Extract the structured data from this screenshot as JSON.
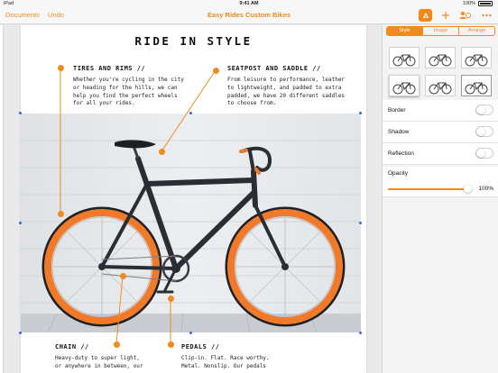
{
  "status_bar": {
    "carrier": "iPad",
    "time": "9:41 AM",
    "battery": "100%"
  },
  "toolbar": {
    "documents_label": "Documents",
    "undo_label": "Undo",
    "title": "Easy Rides Custom Bikes"
  },
  "page": {
    "heading": "RIDE IN STYLE",
    "sections": [
      {
        "title": "TIRES AND RIMS //",
        "body": [
          "Whether you're cycling in the city",
          "or heading for the hills, we can",
          "help you find the perfect wheels",
          "for all your rides."
        ]
      },
      {
        "title": "SEATPOST AND SADDLE //",
        "body": [
          "From leisure to performance, leather",
          "to lightweight, and padded to extra",
          "padded, we have 20 different saddles",
          "to choose from."
        ]
      },
      {
        "title": "CHAIN //",
        "body": [
          "Heavy-duty to super light,",
          "or anywhere in between, our"
        ]
      },
      {
        "title": "PEDALS //",
        "body": [
          "Clip-in. Flat. Race worthy.",
          "Metal. Nonslip. Our pedals"
        ]
      }
    ]
  },
  "sidebar": {
    "tabs": [
      "Style",
      "Image",
      "Arrange"
    ],
    "active_tab": "Style",
    "rows": [
      {
        "label": "Border",
        "on": false
      },
      {
        "label": "Shadow",
        "on": false
      },
      {
        "label": "Reflection",
        "on": false
      }
    ],
    "opacity": {
      "label": "Opacity",
      "value": "100%",
      "fraction": 1.0
    }
  },
  "colors": {
    "accent": "#f08a1c",
    "frame": "#2b2d34",
    "tire": "#f07a2a"
  },
  "icons": [
    "paintbrush-icon",
    "plus-icon",
    "share-collaborate-icon",
    "more-icon"
  ]
}
